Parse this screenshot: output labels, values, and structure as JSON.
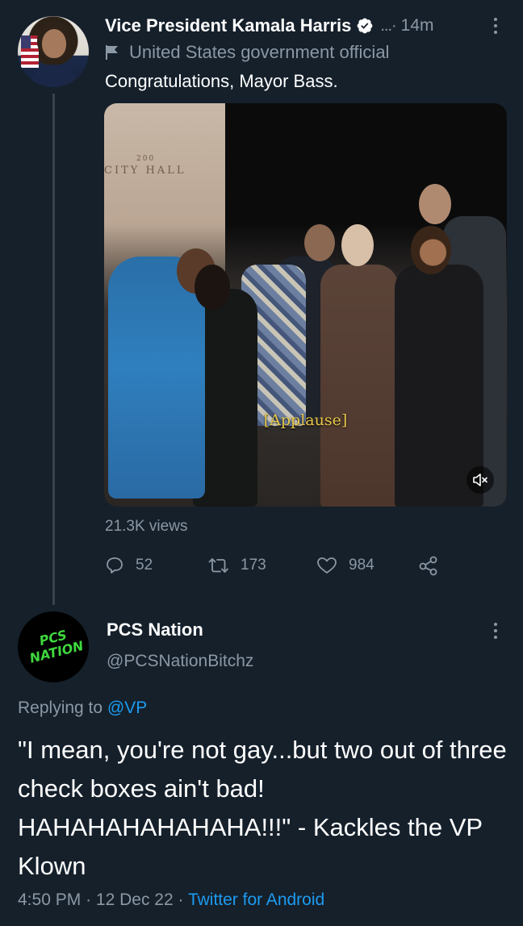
{
  "tweet1": {
    "author_name": "Vice President Kamala Harris",
    "separator": "...·",
    "time": "14m",
    "label": "United States government official",
    "text": "Congratulations, Mayor Bass.",
    "media": {
      "caption": "[Applause]",
      "wall_sign": "CITY HALL",
      "wall_number": "200",
      "icon": "mute-icon"
    },
    "views": "21.3K views",
    "replies": "52",
    "retweets": "173",
    "likes": "984"
  },
  "tweet2": {
    "author_name": "PCS Nation",
    "handle": "@PCSNationBitchz",
    "avatar_text_line1": "PCS",
    "avatar_text_line2": "NATION",
    "replying_prefix": "Replying to",
    "replying_to": "@VP",
    "text": "\"I mean, you're not gay...but two out of three check boxes ain't bad! HAHAHAHAHAHAHA!!!\" - Kackles the VP Klown",
    "time": "4:50 PM",
    "dot1": "·",
    "date": "12 Dec 22",
    "dot2": "·",
    "source": "Twitter for Android"
  },
  "colors": {
    "background": "#15202b",
    "secondary_text": "#8b98a5",
    "accent": "#1d9bf0",
    "caption": "#e8c84a"
  }
}
